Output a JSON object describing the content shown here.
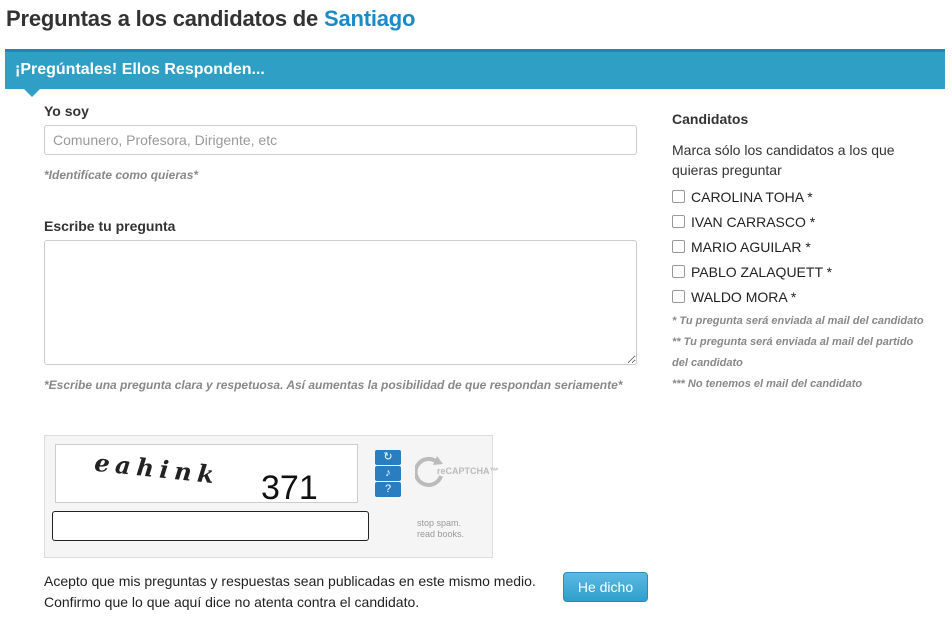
{
  "header": {
    "title_prefix": "Preguntas a los candidatos de",
    "title_city": "Santiago"
  },
  "banner": {
    "text": "¡Pregúntales! Ellos Responden..."
  },
  "form": {
    "identity_label": "Yo soy",
    "identity_placeholder": "Comunero, Profesora, Dirigente, etc",
    "identity_value": "",
    "identity_hint": "*Identifícate como quieras*",
    "question_label": "Escribe tu pregunta",
    "question_value": "",
    "question_hint": "*Escribe una pregunta clara y respetuosa. Así aumentas la posibilidad de que respondan seriamente*",
    "captcha": {
      "word1": "eahink",
      "word2": "371",
      "logo_text": "reCAPTCHA™",
      "slogan_line1": "stop spam.",
      "slogan_line2": "read books.",
      "answer_value": ""
    },
    "accept_line1": "Acepto que mis preguntas y respuestas sean publicadas en este mismo medio.",
    "accept_line2": "Confirmo que lo que aquí dice no atenta contra el candidato.",
    "submit_label": "He dicho"
  },
  "sidebar": {
    "title": "Candidatos",
    "instructions": "Marca sólo los candidatos a los que quieras preguntar",
    "candidates": [
      {
        "label": "CAROLINA TOHA *",
        "checked": false
      },
      {
        "label": "IVAN CARRASCO *",
        "checked": false
      },
      {
        "label": "MARIO AGUILAR *",
        "checked": false
      },
      {
        "label": "PABLO ZALAQUETT *",
        "checked": false
      },
      {
        "label": "WALDO MORA *",
        "checked": false
      }
    ],
    "notes": [
      "* Tu pregunta será enviada al mail del candidato",
      "** Tu pregunta será enviada al mail del partido del candidato",
      "*** No tenemos el mail del candidato"
    ]
  },
  "colors": {
    "accent": "#2f9fc5",
    "city": "#1b8ac6",
    "button": "#39a6d3"
  }
}
